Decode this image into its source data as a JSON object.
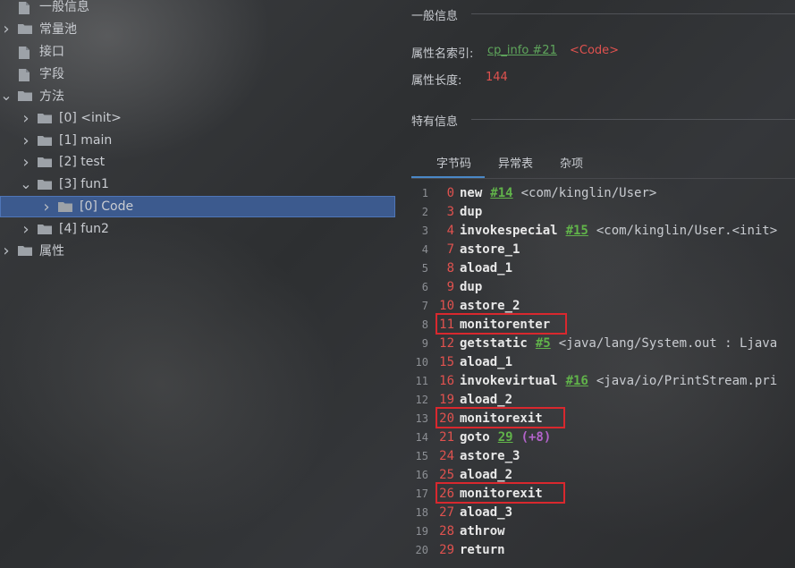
{
  "tree": {
    "items": [
      {
        "label": "一般信息",
        "indent": 0,
        "chevron": "none"
      },
      {
        "label": "常量池",
        "indent": 0,
        "chevron": "right"
      },
      {
        "label": "接口",
        "indent": 0,
        "chevron": "none"
      },
      {
        "label": "字段",
        "indent": 0,
        "chevron": "none"
      },
      {
        "label": "方法",
        "indent": 0,
        "chevron": "down"
      },
      {
        "label": "[0] <init>",
        "indent": 1,
        "chevron": "right"
      },
      {
        "label": "[1] main",
        "indent": 1,
        "chevron": "right"
      },
      {
        "label": "[2] test",
        "indent": 1,
        "chevron": "right"
      },
      {
        "label": "[3] fun1",
        "indent": 1,
        "chevron": "down"
      },
      {
        "label": "[0] Code",
        "indent": 2,
        "chevron": "right",
        "selected": true
      },
      {
        "label": "[4] fun2",
        "indent": 1,
        "chevron": "right"
      },
      {
        "label": "属性",
        "indent": 0,
        "chevron": "right"
      }
    ]
  },
  "general": {
    "title": "一般信息",
    "name_index_label": "属性名索引:",
    "name_index_link": "cp_info #21",
    "name_index_value": "<Code>",
    "length_label": "属性长度:",
    "length_value": "144"
  },
  "specific": {
    "title": "特有信息",
    "tabs": [
      "字节码",
      "异常表",
      "杂项"
    ],
    "active_tab": 0
  },
  "bytecode": [
    {
      "line": "1",
      "offset": "0",
      "op": "new",
      "ref": "#14",
      "comment": "<com/kinglin/User>"
    },
    {
      "line": "2",
      "offset": "3",
      "op": "dup"
    },
    {
      "line": "3",
      "offset": "4",
      "op": "invokespecial",
      "ref": "#15",
      "comment": "<com/kinglin/User.<init>"
    },
    {
      "line": "4",
      "offset": "7",
      "op": "astore_1"
    },
    {
      "line": "5",
      "offset": "8",
      "op": "aload_1"
    },
    {
      "line": "6",
      "offset": "9",
      "op": "dup"
    },
    {
      "line": "7",
      "offset": "10",
      "op": "astore_2"
    },
    {
      "line": "8",
      "offset": "11",
      "op": "monitorenter",
      "highlight": true
    },
    {
      "line": "9",
      "offset": "12",
      "op": "getstatic",
      "ref": "#5",
      "comment": "<java/lang/System.out : Ljava"
    },
    {
      "line": "10",
      "offset": "15",
      "op": "aload_1"
    },
    {
      "line": "11",
      "offset": "16",
      "op": "invokevirtual",
      "ref": "#16",
      "comment": "<java/io/PrintStream.pri"
    },
    {
      "line": "12",
      "offset": "19",
      "op": "aload_2"
    },
    {
      "line": "13",
      "offset": "20",
      "op": "monitorexit",
      "highlight": true
    },
    {
      "line": "14",
      "offset": "21",
      "op": "goto",
      "ref": "29",
      "extra": "(+8)"
    },
    {
      "line": "15",
      "offset": "24",
      "op": "astore_3"
    },
    {
      "line": "16",
      "offset": "25",
      "op": "aload_2"
    },
    {
      "line": "17",
      "offset": "26",
      "op": "monitorexit",
      "highlight": true
    },
    {
      "line": "18",
      "offset": "27",
      "op": "aload_3"
    },
    {
      "line": "19",
      "offset": "28",
      "op": "athrow"
    },
    {
      "line": "20",
      "offset": "29",
      "op": "return"
    }
  ],
  "colors": {
    "selection": "#3c5a8e",
    "highlight_box": "#d9282e",
    "link_green": "#5fa65c",
    "value_red": "#e0524f",
    "tab_accent": "#4a88c7"
  }
}
